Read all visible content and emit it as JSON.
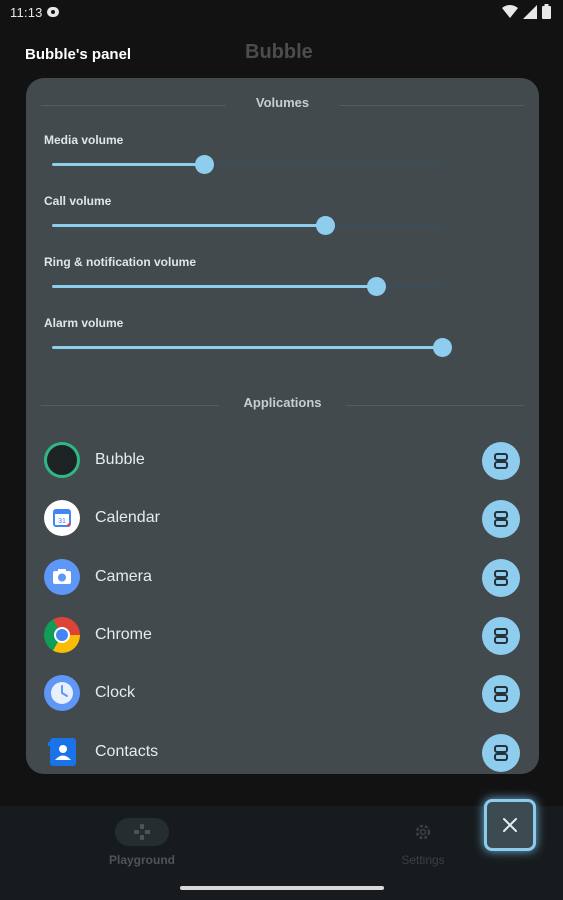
{
  "status_bar": {
    "time": "11:13",
    "icons": [
      "notification-icon",
      "wifi-icon",
      "signal-icon",
      "battery-icon"
    ]
  },
  "header": {
    "panel_title": "Bubble's panel",
    "app_name": "Bubble"
  },
  "panel": {
    "volumes_title": "Volumes",
    "volumes": [
      {
        "label": "Media volume",
        "level": 0.39
      },
      {
        "label": "Call volume",
        "level": 0.7
      },
      {
        "label": "Ring & notification volume",
        "level": 0.83
      },
      {
        "label": "Alarm volume",
        "level": 1.0
      }
    ],
    "applications_title": "Applications",
    "applications": [
      {
        "name": "Bubble",
        "icon": "bubble-app-icon"
      },
      {
        "name": "Calendar",
        "icon": "calendar-app-icon"
      },
      {
        "name": "Camera",
        "icon": "camera-app-icon"
      },
      {
        "name": "Chrome",
        "icon": "chrome-app-icon"
      },
      {
        "name": "Clock",
        "icon": "clock-app-icon"
      },
      {
        "name": "Contacts",
        "icon": "contacts-app-icon"
      }
    ]
  },
  "bottom_nav": {
    "items": [
      {
        "label": "Playground",
        "icon": "gamepad-icon",
        "active": true
      },
      {
        "label": "Settings",
        "icon": "gear-icon",
        "active": false
      }
    ]
  },
  "colors": {
    "accent": "#8fcdef",
    "panel_bg": "#424a4e",
    "background": "#121212"
  }
}
